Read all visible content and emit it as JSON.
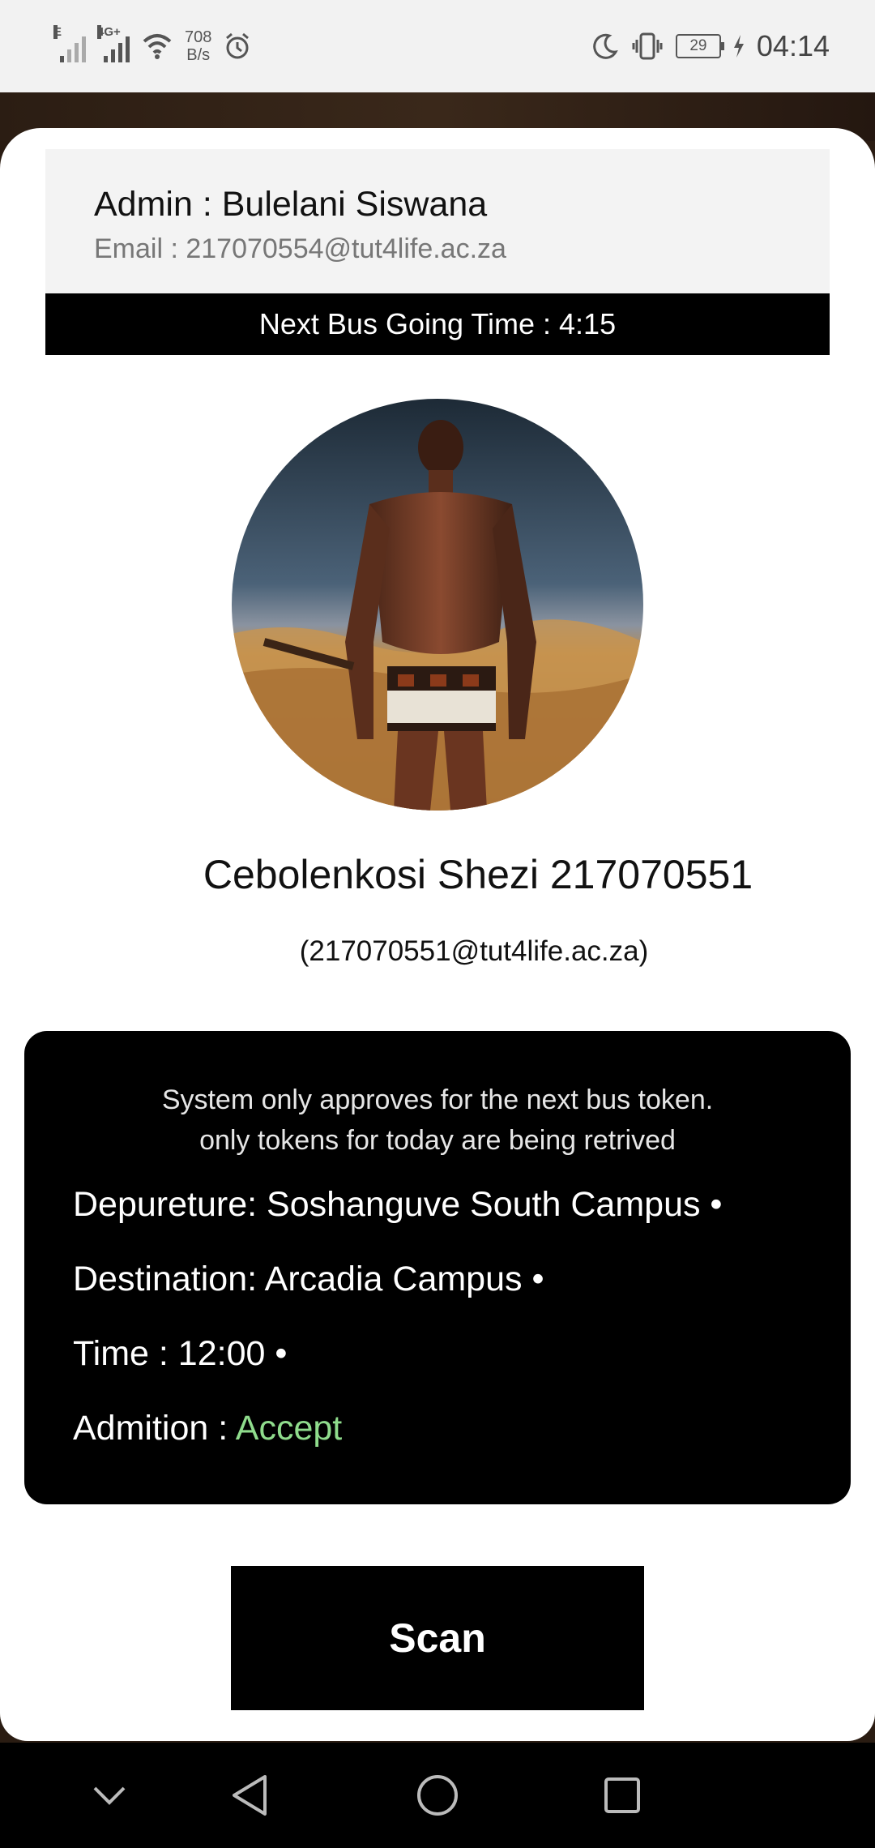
{
  "status_bar": {
    "signal1_tag": "E",
    "signal2_tag": "4G+",
    "net_speed_value": "708",
    "net_speed_unit": "B/s",
    "battery": "29",
    "time": "04:14",
    "icons": [
      "signal-icon",
      "signal-4g-icon",
      "wifi-icon",
      "alarm-icon",
      "moon-icon",
      "vibrate-icon",
      "battery-icon",
      "charging-icon"
    ]
  },
  "admin": {
    "name": "Admin : Bulelani Siswana",
    "email": "Email : 217070554@tut4life.ac.za"
  },
  "next_bus": "Next Bus Going Time : 4:15",
  "student": {
    "name": "Cebolenkosi Shezi 217070551",
    "email": "(217070551@tut4life.ac.za)"
  },
  "token_info": {
    "notice_line1": "System only approves for the next bus token.",
    "notice_line2": "only tokens for today are being retrived",
    "departure": "Depureture: Soshanguve South Campus •",
    "destination": "Destination: Arcadia Campus •",
    "time": "Time : 12:00 •",
    "admission_label": "Admition : ",
    "admission_value": "Accept"
  },
  "scan_button": "Scan",
  "colors": {
    "accent_green": "#8fdc8c",
    "dark": "#000000",
    "admin_bg": "#f3f3f3"
  },
  "nav_bar": {
    "icons": [
      "chevron-down-icon",
      "back-icon",
      "home-icon",
      "recents-icon"
    ]
  }
}
